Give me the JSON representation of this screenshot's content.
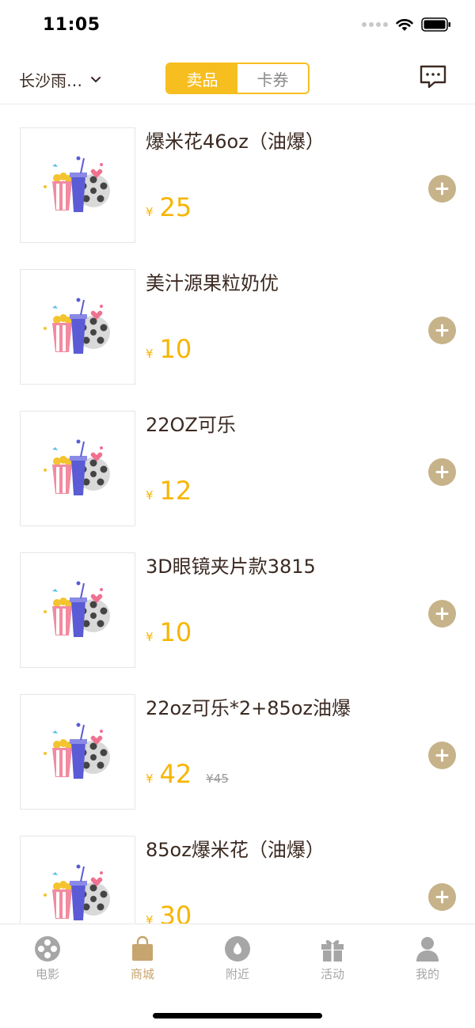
{
  "status_bar": {
    "time": "11:05"
  },
  "header": {
    "city": "长沙雨…",
    "tabs": [
      {
        "label": "卖品",
        "active": true
      },
      {
        "label": "卡券",
        "active": false
      }
    ]
  },
  "currency_symbol": "¥",
  "products": [
    {
      "name": "爆米花46oz（油爆）",
      "price": "25"
    },
    {
      "name": "美汁源果粒奶优",
      "price": "10"
    },
    {
      "name": "22OZ可乐",
      "price": "12"
    },
    {
      "name": "3D眼镜夹片款3815",
      "price": "10"
    },
    {
      "name": "22oz可乐*2+85oz油爆",
      "price": "42",
      "original_price": "¥45"
    },
    {
      "name": "85oz爆米花（油爆）",
      "price": "30"
    }
  ],
  "tab_bar": [
    {
      "label": "电影",
      "icon": "film-reel-icon",
      "active": false
    },
    {
      "label": "商城",
      "icon": "shopping-bag-icon",
      "active": true
    },
    {
      "label": "附近",
      "icon": "location-icon",
      "active": false
    },
    {
      "label": "活动",
      "icon": "gift-icon",
      "active": false
    },
    {
      "label": "我的",
      "icon": "user-icon",
      "active": false
    }
  ],
  "colors": {
    "accent": "#f7be1f",
    "price": "#f7b500",
    "add_button": "#c7b38a",
    "tab_active": "#c7a56e"
  }
}
